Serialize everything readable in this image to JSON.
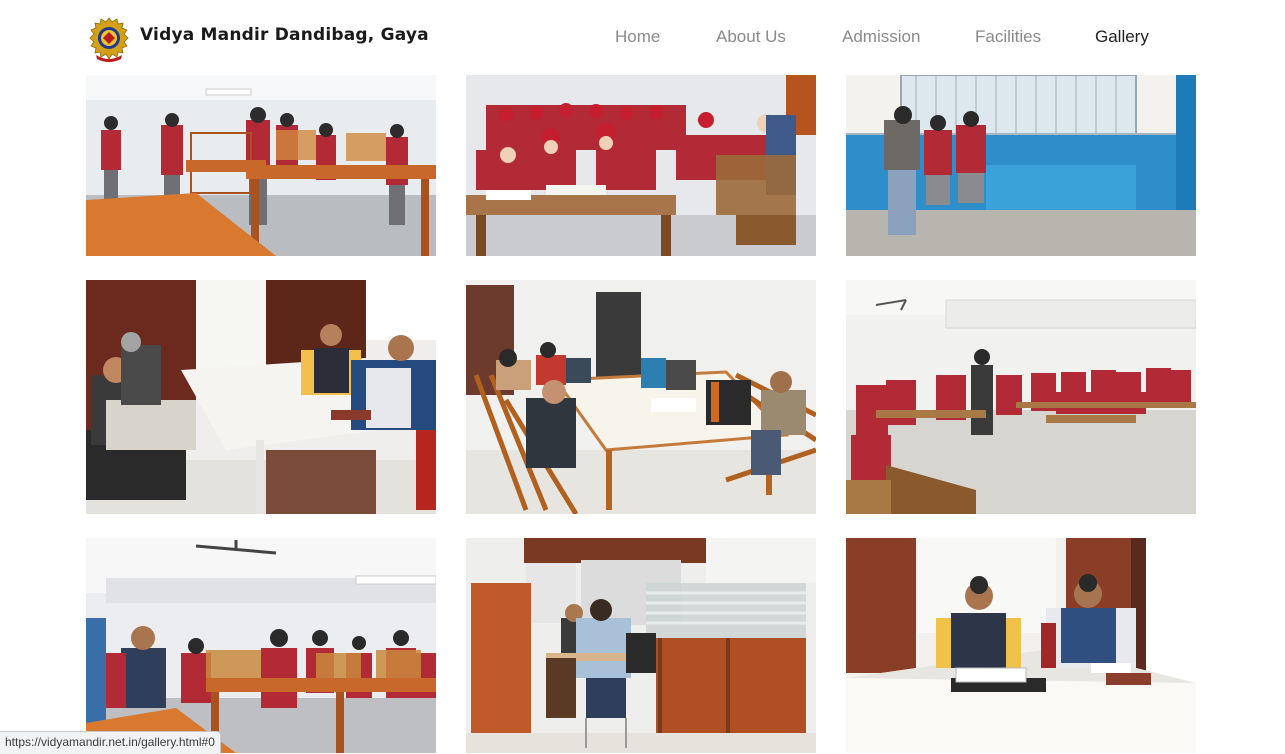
{
  "header": {
    "brand_name": "Vidya Mandir Dandibag, Gaya",
    "logo_icon": "school-crest-logo"
  },
  "nav": {
    "items": [
      {
        "label": "Home"
      },
      {
        "label": "About Us"
      },
      {
        "label": "Admission"
      },
      {
        "label": "Facilities"
      },
      {
        "label": "Gallery",
        "active": true
      }
    ]
  },
  "gallery": {
    "photos": [
      {
        "scene": "lab-students-tables"
      },
      {
        "scene": "classroom-students-benches"
      },
      {
        "scene": "office-counter-window"
      },
      {
        "scene": "principal-office-meeting"
      },
      {
        "scene": "staff-meeting-room"
      },
      {
        "scene": "hall-students-benches"
      },
      {
        "scene": "lab-students-teacher"
      },
      {
        "scene": "office-cubicles"
      },
      {
        "scene": "principal-office-desk"
      }
    ]
  },
  "status_bar": {
    "url": "https://vidyamandir.net.in/gallery.html#0"
  },
  "colors": {
    "nav_inactive": "#8a8a8a",
    "nav_active": "#222222",
    "uniform_red": "#b22a35",
    "table_orange": "#c8692b",
    "wall_blue": "#2d8ec9"
  }
}
